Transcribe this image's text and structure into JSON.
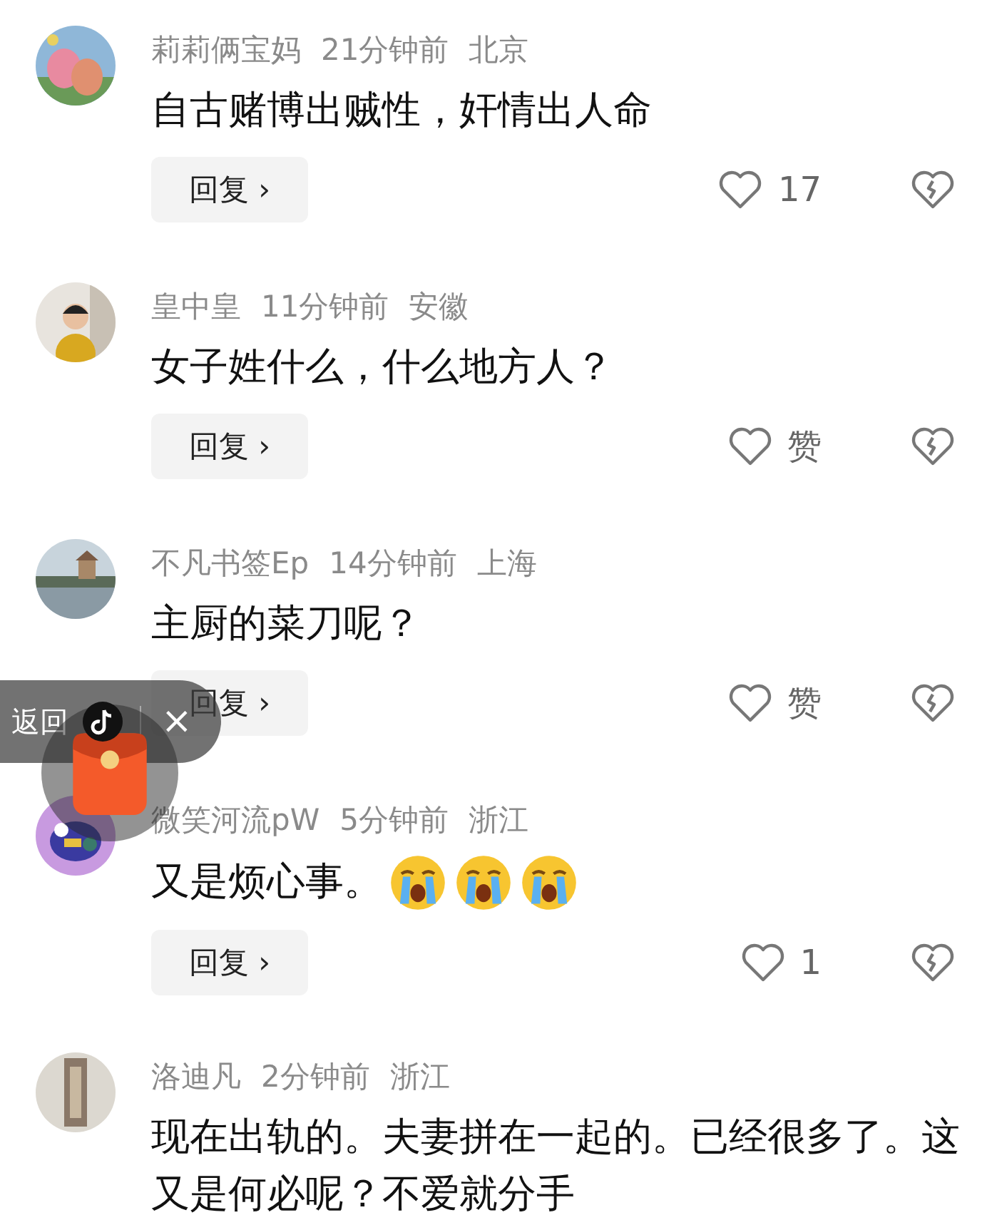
{
  "comments": [
    {
      "user": "莉莉俩宝妈",
      "time": "21分钟前",
      "location": "北京",
      "text": "自古赌博出贼性，奸情出人命",
      "reply": "回复 ›",
      "like_count": "17"
    },
    {
      "user": "皇中皇",
      "time": "11分钟前",
      "location": "安徽",
      "text": "女子姓什么，什么地方人？",
      "reply": "回复 ›",
      "like_count": "赞"
    },
    {
      "user": "不凡书签Ep",
      "time": "14分钟前",
      "location": "上海",
      "text": "主厨的菜刀呢？",
      "reply": "回复 ›",
      "like_count": "赞"
    },
    {
      "user": "微笑河流pW",
      "time": "5分钟前",
      "location": "浙江",
      "text": "又是烦心事。",
      "emojis": [
        {
          "kind": "crying"
        },
        {
          "kind": "crying"
        },
        {
          "kind": "crying"
        }
      ],
      "reply": "回复 ›",
      "like_count": "1"
    },
    {
      "user": "洛迪凡",
      "time": "2分钟前",
      "location": "浙江",
      "text": "现在出轨的。夫妻拼在一起的。已经很多了。这又是何必呢？不爱就分手"
    }
  ],
  "floating_widget": {
    "back": "返回",
    "close": "×"
  }
}
